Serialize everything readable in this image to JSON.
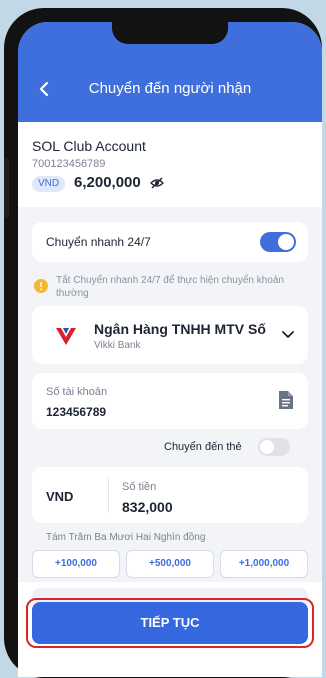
{
  "header": {
    "title": "Chuyển đến người nhận"
  },
  "account": {
    "name": "SOL Club Account",
    "number": "700123456789",
    "currency": "VND",
    "balance": "6,200,000"
  },
  "fast_transfer": {
    "label": "Chuyển nhanh 24/7",
    "enabled": true,
    "notice": "Tắt Chuyển nhanh 24/7 để thực hiện chuyển khoản thường"
  },
  "bank": {
    "name": "Ngân Hàng TNHH MTV Số...",
    "short": "Vikki Bank"
  },
  "account_field": {
    "label": "Số tài khoản",
    "value": "123456789"
  },
  "card_transfer": {
    "label": "Chuyển đến thẻ",
    "enabled": false
  },
  "amount": {
    "currency": "VND",
    "label": "Số tiền",
    "value": "832,000",
    "in_words": "Tám Trăm Ba Mươi Hai Nghìn đồng"
  },
  "quick_amounts": [
    "+100,000",
    "+500,000",
    "+1,000,000"
  ],
  "actions": {
    "continue_label": "TIẾP TỤC"
  },
  "colors": {
    "primary": "#3f6fdc",
    "highlight_outline": "#d9262e",
    "warning": "#f5b82e"
  }
}
